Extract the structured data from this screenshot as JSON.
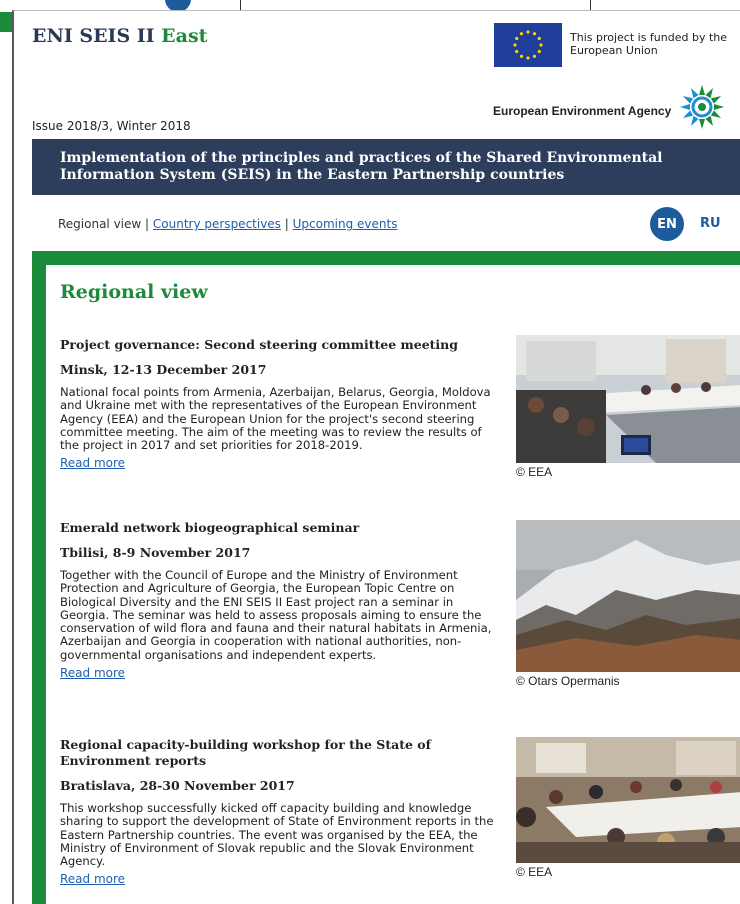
{
  "header": {
    "brand_main": "ENI SEIS II ",
    "brand_accent": "East",
    "eu_funded": "This project is funded by the European Union",
    "eea_name": "European Environment Agency",
    "issue": "Issue 2018/3, Winter 2018"
  },
  "banner": {
    "text": "Implementation of the principles and practices of the Shared Environmental Information System (SEIS) in the Eastern Partnership countries"
  },
  "nav": {
    "current": "Regional view",
    "separator": " | ",
    "link1": "Country perspectives",
    "link2": "Upcoming events"
  },
  "languages": {
    "en": "EN",
    "ru": "RU"
  },
  "section_title": "Regional view",
  "articles": [
    {
      "title": "Project governance: Second steering committee meeting",
      "subtitle": "Minsk, 12-13 December 2017",
      "body": "National focal points from Armenia, Azerbaijan, Belarus, Georgia, Moldova and Ukraine met with the representatives of the European Environment Agency (EEA) and the European Union for the project's second steering committee meeting. The aim of the meeting was to review the results of the project in 2017 and set priorities for 2018-2019.",
      "read_more": "Read more",
      "caption": "© EEA"
    },
    {
      "title": "Emerald network biogeographical seminar",
      "subtitle": "Tbilisi, 8-9 November 2017",
      "body": "Together with the Council of Europe and the Ministry of Environment Protection and Agriculture of Georgia, the European Topic Centre on Biological Diversity and the ENI SEIS II East project ran a seminar in Georgia. The seminar was held to assess proposals aiming to ensure the conservation of wild flora and fauna and their natural habitats in Armenia, Azerbaijan and Georgia in cooperation with national authorities, non-governmental organisations and independent experts.",
      "read_more": "Read more",
      "caption": "© Otars Opermanis"
    },
    {
      "title": "Regional capacity-building workshop for the State of Environment reports",
      "subtitle": "Bratislava, 28-30 November 2017",
      "body": "This workshop successfully kicked off capacity building and knowledge sharing to support the development of State of Environment reports in the Eastern Partnership countries. The event was organised by the EEA, the Ministry of Environment of Slovak republic and the Slovak Environment Agency.",
      "read_more": "Read more",
      "caption": "© EEA"
    }
  ],
  "colors": {
    "green": "#1b8a3a",
    "navy": "#2c3e5c",
    "link": "#1f5fb0",
    "eu_blue": "#1f3f9a",
    "eu_gold": "#ffd200"
  }
}
